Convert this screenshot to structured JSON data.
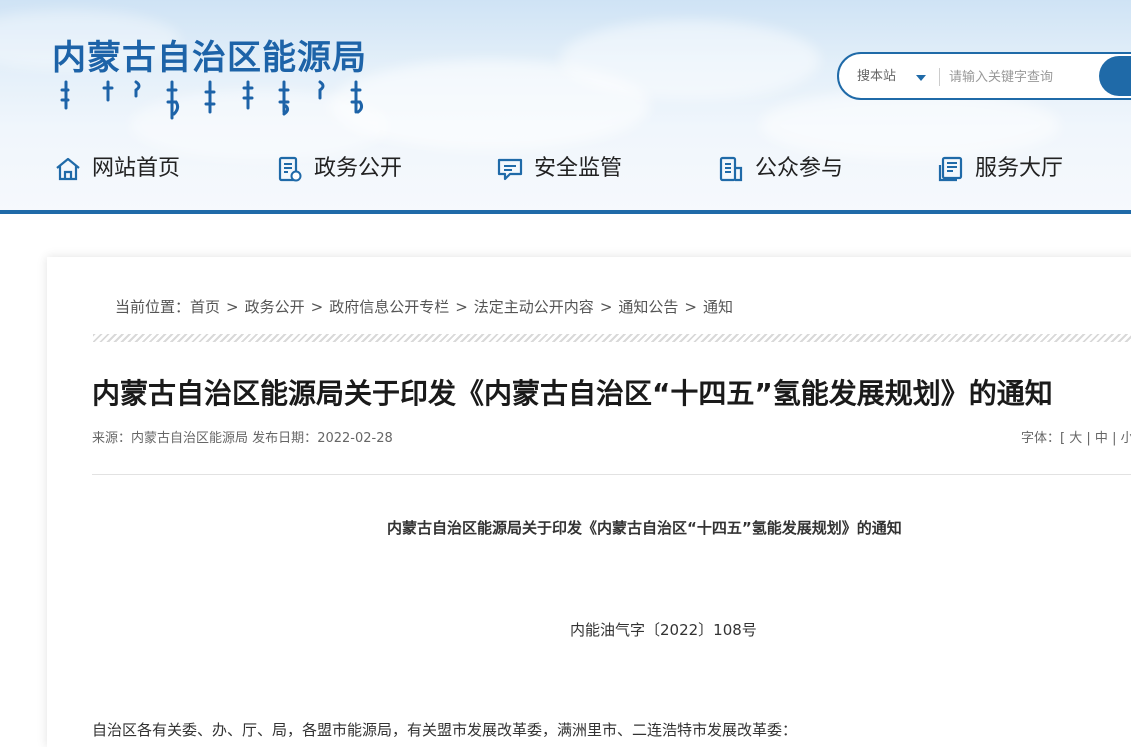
{
  "site": {
    "title": "内蒙古自治区能源局"
  },
  "search": {
    "scope": "搜本站",
    "placeholder": "请输入关键字查询"
  },
  "nav": {
    "items": [
      {
        "label": "网站首页",
        "icon": "home-icon"
      },
      {
        "label": "政务公开",
        "icon": "document-icon"
      },
      {
        "label": "安全监管",
        "icon": "chat-icon"
      },
      {
        "label": "公众参与",
        "icon": "clipboard-icon"
      },
      {
        "label": "服务大厅",
        "icon": "service-icon"
      }
    ]
  },
  "breadcrumb": {
    "prefix": "当前位置：",
    "items": [
      "首页",
      "政务公开",
      "政府信息公开专栏",
      "法定主动公开内容",
      "通知公告",
      "通知"
    ],
    "separator": ">"
  },
  "article": {
    "title": "内蒙古自治区能源局关于印发《内蒙古自治区“十四五”氢能发展规划》的通知",
    "source_label": "来源：",
    "source": "内蒙古自治区能源局",
    "date_label": "发布日期：",
    "date": "2022-02-28",
    "fontsize_label": "字体：",
    "fontsize_open": "[",
    "fontsize_options": [
      "大",
      "中",
      "小"
    ],
    "fontsize_sep": "|",
    "doc_heading": "内蒙古自治区能源局关于印发《内蒙古自治区“十四五”氢能发展规划》的通知",
    "doc_number": "内能油气字〔2022〕108号",
    "body_first_line": "自治区各有关委、办、厅、局，各盟市能源局，有关盟市发展改革委，满洲里市、二连浩特市发展改革委："
  },
  "colors": {
    "brand": "#1d63a8",
    "accent": "#1f6aa8"
  }
}
